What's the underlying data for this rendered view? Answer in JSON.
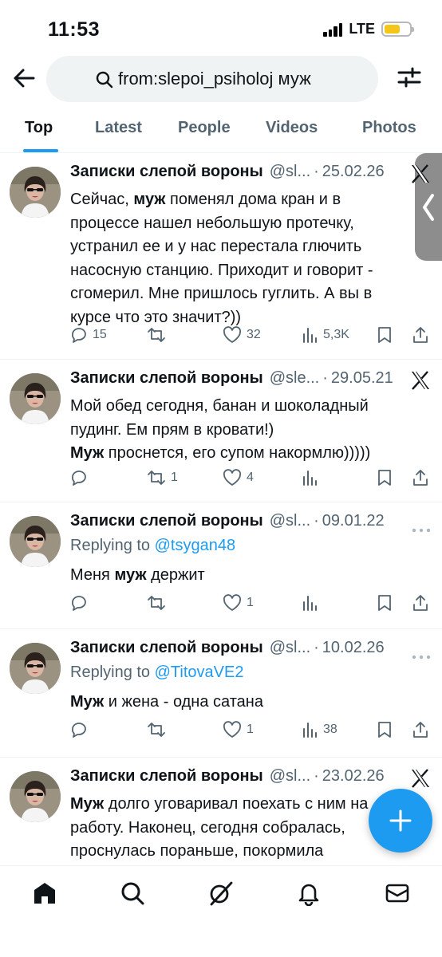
{
  "status_bar": {
    "time": "11:53",
    "network": "LTE"
  },
  "search": {
    "query": "from:slepoi_psiholoj муж"
  },
  "tabs": [
    {
      "label": "Top",
      "active": true
    },
    {
      "label": "Latest",
      "active": false
    },
    {
      "label": "People",
      "active": false
    },
    {
      "label": "Videos",
      "active": false
    },
    {
      "label": "Photos",
      "active": false
    }
  ],
  "tweets": [
    {
      "name": "Записки слепой вороны",
      "handle": "@sl...",
      "dot": "·",
      "date": "25.02.26",
      "badge_icon": "x-logo-icon",
      "replying_label": "",
      "replying_handle": "",
      "body_parts": [
        {
          "text": "Сейчас, "
        },
        {
          "text": "муж",
          "bold": true
        },
        {
          "text": " поменял дома кран и в процессе нашел небольшую протечку, устранил ее и у нас перестала глючить насосную станцию. Приходит и говорит - сгомерил. Мне пришлось гуглить. А вы в курсе что это значит?))"
        }
      ],
      "replies": "15",
      "retweets": "",
      "likes": "32",
      "views": "5,3K"
    },
    {
      "name": "Записки слепой вороны",
      "handle": "@sle...",
      "dot": "·",
      "date": "29.05.21",
      "badge_icon": "x-logo-icon",
      "replying_label": "",
      "replying_handle": "",
      "body_parts": [
        {
          "text": "Мой обед сегодня, банан и шоколадный пудинг. Ем прям в кровати!)"
        },
        {
          "text": "\n"
        },
        {
          "text": "Муж",
          "bold": true
        },
        {
          "text": " проснется, его супом накормлю)))))"
        }
      ],
      "replies": "",
      "retweets": "1",
      "likes": "4",
      "views": ""
    },
    {
      "name": "Записки слепой вороны",
      "handle": "@sl...",
      "dot": "·",
      "date": "09.01.22",
      "badge_icon": "more-icon",
      "replying_label": "Replying to ",
      "replying_handle": "@tsygan48",
      "body_parts": [
        {
          "text": "Меня "
        },
        {
          "text": "муж",
          "bold": true
        },
        {
          "text": " держит"
        }
      ],
      "replies": "",
      "retweets": "",
      "likes": "1",
      "views": ""
    },
    {
      "name": "Записки слепой вороны",
      "handle": "@sl...",
      "dot": "·",
      "date": "10.02.26",
      "badge_icon": "more-icon",
      "replying_label": "Replying to ",
      "replying_handle": "@TitovaVE2",
      "body_parts": [
        {
          "text": "Муж",
          "bold": true
        },
        {
          "text": " и жена - одна сатана"
        }
      ],
      "replies": "",
      "retweets": "",
      "likes": "1",
      "views": "38"
    },
    {
      "name": "Записки слепой вороны",
      "handle": "@sl...",
      "dot": "·",
      "date": "23.02.26",
      "badge_icon": "x-logo-icon",
      "replying_label": "",
      "replying_handle": "",
      "body_parts": [
        {
          "text": "Муж",
          "bold": true
        },
        {
          "text": " долго уговаривал поехать с ним на работу. Наконец, сегодня собралась, проснулась пораньше, покормила"
        }
      ],
      "replies": "",
      "retweets": "",
      "likes": "",
      "views": ""
    }
  ],
  "bottom_nav": [
    {
      "icon": "home-icon",
      "active": true
    },
    {
      "icon": "search-icon",
      "active": false
    },
    {
      "icon": "grok-icon",
      "active": false
    },
    {
      "icon": "bell-icon",
      "active": false
    },
    {
      "icon": "mail-icon",
      "active": false
    }
  ],
  "colors": {
    "accent": "#1d9bf0",
    "text": "#0f1419",
    "muted": "#536471",
    "battery": "#f5c518"
  }
}
